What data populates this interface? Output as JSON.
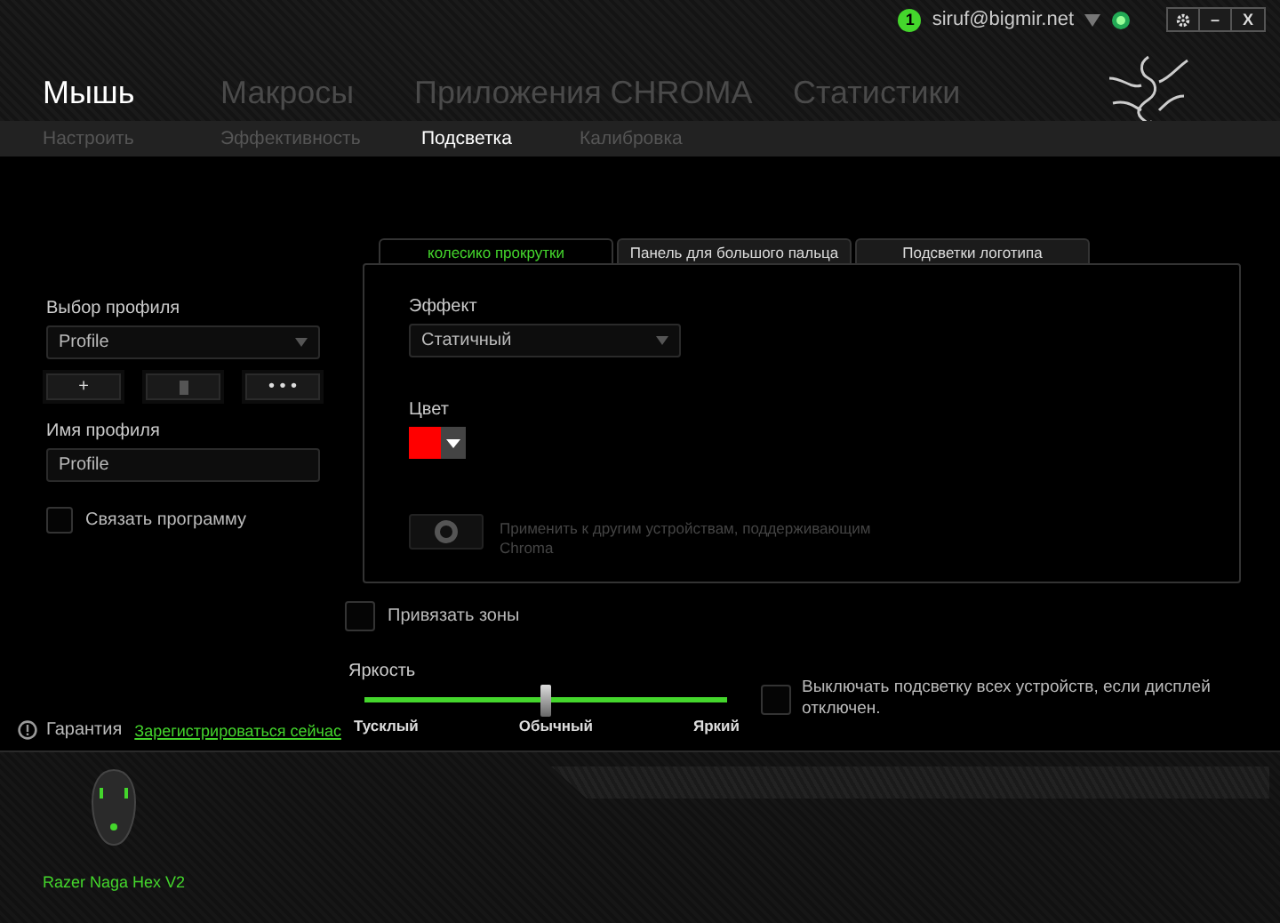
{
  "account": {
    "badge": "1",
    "email": "siruf@bigmir.net"
  },
  "window_controls": [
    {
      "kind": "settings"
    },
    {
      "kind": "text",
      "label": "–"
    },
    {
      "kind": "text",
      "label": "X"
    }
  ],
  "main_nav": [
    {
      "label": "Мышь",
      "selected": true
    },
    {
      "label": "Макросы",
      "selected": false
    },
    {
      "label": "Приложения CHROMA",
      "selected": false
    },
    {
      "label": "Статистики",
      "selected": false
    }
  ],
  "sub_nav": [
    {
      "label": "Настроить",
      "selected": false
    },
    {
      "label": "Эффективность",
      "selected": false
    },
    {
      "label": "Подсветка",
      "selected": true
    },
    {
      "label": "Калибровка",
      "selected": false
    }
  ],
  "profile": {
    "label": "Выбор профиля",
    "value": "Profile",
    "buttons": [
      {
        "kind": "text",
        "label": "+"
      },
      {
        "kind": "delete"
      },
      {
        "kind": "text",
        "label": "• • •"
      }
    ],
    "name_label": "Имя профиля",
    "name_value": "Profile",
    "link_program": {
      "label": "Связать программу",
      "checked": false
    }
  },
  "warranty": {
    "label": "Гарантия",
    "link": "Зарегистрироваться сейчас"
  },
  "zone_tabs": [
    {
      "label": "колесико прокрутки",
      "selected": true
    },
    {
      "label": "Панель для большого пальца",
      "selected": false
    },
    {
      "label": "Подсветки логотипа",
      "selected": false
    }
  ],
  "effect": {
    "label": "Эффект",
    "value": "Статичный"
  },
  "color": {
    "label": "Цвет",
    "color": "#ff0000"
  },
  "apply_chroma": {
    "label": "Применить к другим устройствам, поддерживающим Chroma",
    "on": false
  },
  "link_zones": {
    "label": "Привязать зоны",
    "checked": false
  },
  "brightness": {
    "label": "Яркость",
    "level": 0.5,
    "ticks": [
      "Тусклый",
      "Обычный",
      "Яркий"
    ]
  },
  "display_off": {
    "label": "Выключать подсветку всех устройств, если дисплей отключен.",
    "checked": false
  },
  "device": {
    "name": "Razer Naga Hex V2"
  }
}
